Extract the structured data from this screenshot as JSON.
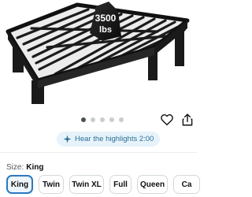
{
  "product_image": {
    "badge_line1": "3500",
    "badge_line2": "lbs"
  },
  "carousel": {
    "dot_count": 5,
    "active_index": 0
  },
  "actions": {
    "favorite_icon": "heart-icon",
    "share_icon": "share-icon"
  },
  "highlights": {
    "label": "Hear the highlights 2:00",
    "icon": "sparkle-icon",
    "color": "#2a6f97",
    "background": "#e7f3fb"
  },
  "size": {
    "label": "Size:",
    "selected": "King",
    "options": [
      {
        "label": "King"
      },
      {
        "label": "Twin"
      },
      {
        "label": "Twin XL"
      },
      {
        "label": "Full"
      },
      {
        "label": "Queen"
      },
      {
        "label": "Ca"
      }
    ]
  },
  "colors": {
    "selected_border": "#2b78c2",
    "text": "#0f1111"
  }
}
